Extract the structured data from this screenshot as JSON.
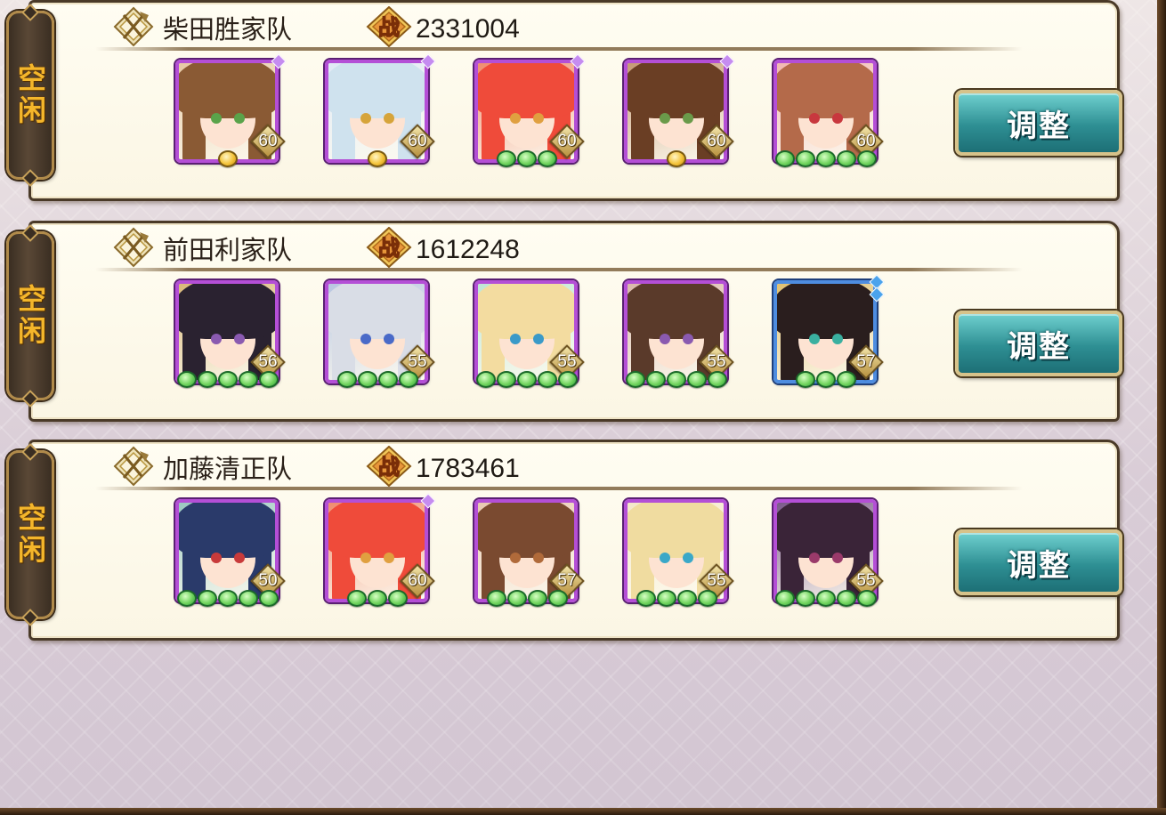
{
  "teams": [
    {
      "status": "空闲",
      "name": "柴田胜家队",
      "power": "2331004",
      "button_label": "调整",
      "members": [
        {
          "level": "60",
          "frame": "purple",
          "star_marks": 1,
          "gems": [
            "gold"
          ],
          "hair": "#8a5a34",
          "eyes": "#5aa34a",
          "bg": "#e6c9a4"
        },
        {
          "level": "60",
          "frame": "purple",
          "star_marks": 1,
          "gems": [
            "gold"
          ],
          "hair": "#cfe2ee",
          "eyes": "#d6a43a",
          "bg": "#dfe9f5"
        },
        {
          "level": "60",
          "frame": "purple",
          "star_marks": 1,
          "gems": [
            "green",
            "green",
            "green"
          ],
          "hair": "#ef4b3a",
          "eyes": "#e0a040",
          "bg": "#f08c6e"
        },
        {
          "level": "60",
          "frame": "purple",
          "star_marks": 1,
          "gems": [
            "gold"
          ],
          "hair": "#6a3e24",
          "eyes": "#6a9a4a",
          "bg": "#c59a74"
        },
        {
          "level": "60",
          "frame": "purple",
          "star_marks": 0,
          "gems": [
            "green",
            "green",
            "green",
            "green",
            "green"
          ],
          "hair": "#b46a4a",
          "eyes": "#c8383e",
          "bg": "#f1b8b0"
        }
      ]
    },
    {
      "status": "空闲",
      "name": "前田利家队",
      "power": "1612248",
      "button_label": "调整",
      "members": [
        {
          "level": "56",
          "frame": "purple",
          "star_marks": 0,
          "gems": [
            "green",
            "green",
            "green",
            "green",
            "green"
          ],
          "hair": "#2a2230",
          "eyes": "#8a5ab0",
          "bg": "#d8b878"
        },
        {
          "level": "55",
          "frame": "purple",
          "star_marks": 0,
          "gems": [
            "green",
            "green",
            "green",
            "green"
          ],
          "hair": "#d9dde6",
          "eyes": "#4a6ac8",
          "bg": "#b8c6e0"
        },
        {
          "level": "55",
          "frame": "purple",
          "star_marks": 0,
          "gems": [
            "green",
            "green",
            "green",
            "green",
            "green"
          ],
          "hair": "#f3dca0",
          "eyes": "#3a9ac8",
          "bg": "#bfe6d4"
        },
        {
          "level": "55",
          "frame": "purple",
          "star_marks": 0,
          "gems": [
            "green",
            "green",
            "green",
            "green",
            "green"
          ],
          "hair": "#5a3a2a",
          "eyes": "#8a5ab0",
          "bg": "#d9b8a8"
        },
        {
          "level": "57",
          "frame": "blue",
          "star_marks": 2,
          "gems": [
            "green",
            "green",
            "green"
          ],
          "hair": "#2a1e1e",
          "eyes": "#3ab0a0",
          "bg": "#e0c070"
        }
      ]
    },
    {
      "status": "空闲",
      "name": "加藤清正队",
      "power": "1783461",
      "button_label": "调整",
      "members": [
        {
          "level": "50",
          "frame": "purple",
          "star_marks": 0,
          "gems": [
            "green",
            "green",
            "green",
            "green",
            "green"
          ],
          "hair": "#2a3a6a",
          "eyes": "#c83a3a",
          "bg": "#9ac8c0"
        },
        {
          "level": "60",
          "frame": "purple",
          "star_marks": 1,
          "gems": [
            "green",
            "green",
            "green"
          ],
          "hair": "#ef4b3a",
          "eyes": "#e0a040",
          "bg": "#f08c6e"
        },
        {
          "level": "57",
          "frame": "purple",
          "star_marks": 0,
          "gems": [
            "green",
            "green",
            "green",
            "green"
          ],
          "hair": "#7a4a30",
          "eyes": "#b06a3a",
          "bg": "#e8c8b0"
        },
        {
          "level": "55",
          "frame": "purple",
          "star_marks": 0,
          "gems": [
            "green",
            "green",
            "green",
            "green"
          ],
          "hair": "#f0dca0",
          "eyes": "#3aa8c8",
          "bg": "#f4e8c8"
        },
        {
          "level": "55",
          "frame": "purple",
          "star_marks": 0,
          "gems": [
            "green",
            "green",
            "green",
            "green",
            "green"
          ],
          "hair": "#3a2438",
          "eyes": "#9a3a6a",
          "bg": "#7a5a8a"
        }
      ]
    }
  ],
  "icons": {
    "team_emblem": "crossed-axe-emblem-icon",
    "battle_badge": "battle-power-icon",
    "battle_badge_text": "战"
  },
  "colors": {
    "status_text": "#f4b62b",
    "panel_bg": "#fffdf2",
    "button_bg": "#2e8f93",
    "gem_green": "#6fd35c",
    "gem_gold": "#f4c43a",
    "frame_purple": "#b44fd6",
    "frame_blue": "#4e8de0"
  }
}
